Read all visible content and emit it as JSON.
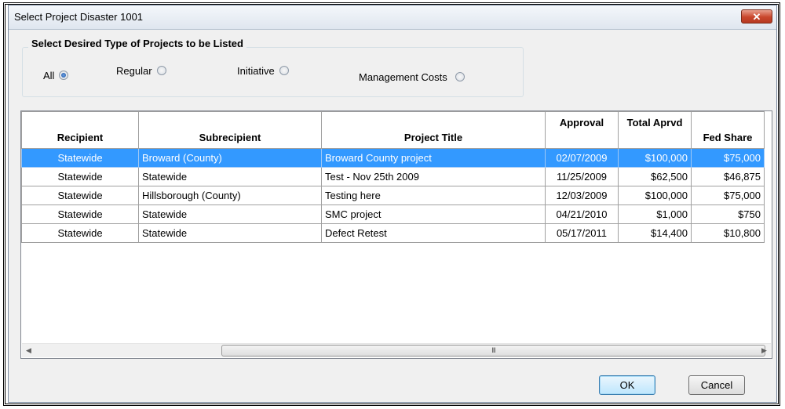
{
  "window": {
    "title": "Select Project   Disaster 1001",
    "close_label": "✕"
  },
  "project_type": {
    "group_title": "Select Desired Type of Projects to be Listed",
    "options": [
      {
        "label": "All",
        "checked": true
      },
      {
        "label": "Regular",
        "checked": false
      },
      {
        "label": "Initiative",
        "checked": false
      },
      {
        "label": "Management Costs",
        "checked": false
      }
    ]
  },
  "grid": {
    "columns": [
      "Recipient",
      "Subrecipient",
      "Project Title",
      "Approval",
      "Total Aprvd",
      "Fed Share"
    ],
    "rows": [
      {
        "recipient": "Statewide",
        "subrecipient": "Broward (County)",
        "title": "Broward County project",
        "approval": "02/07/2009",
        "total": "$100,000",
        "fed": "$75,000",
        "selected": true
      },
      {
        "recipient": "Statewide",
        "subrecipient": "Statewide",
        "title": "Test - Nov 25th 2009",
        "approval": "11/25/2009",
        "total": "$62,500",
        "fed": "$46,875",
        "selected": false
      },
      {
        "recipient": "Statewide",
        "subrecipient": "Hillsborough (County)",
        "title": "Testing here",
        "approval": "12/03/2009",
        "total": "$100,000",
        "fed": "$75,000",
        "selected": false
      },
      {
        "recipient": "Statewide",
        "subrecipient": "Statewide",
        "title": "SMC project",
        "approval": "04/21/2010",
        "total": "$1,000",
        "fed": "$750",
        "selected": false
      },
      {
        "recipient": "Statewide",
        "subrecipient": "Statewide",
        "title": "Defect Retest",
        "approval": "05/17/2011",
        "total": "$14,400",
        "fed": "$10,800",
        "selected": false
      }
    ],
    "scroll_thumb_grip": "III",
    "scroll_left": "◀",
    "scroll_right": "▶"
  },
  "buttons": {
    "ok": "OK",
    "cancel": "Cancel"
  }
}
